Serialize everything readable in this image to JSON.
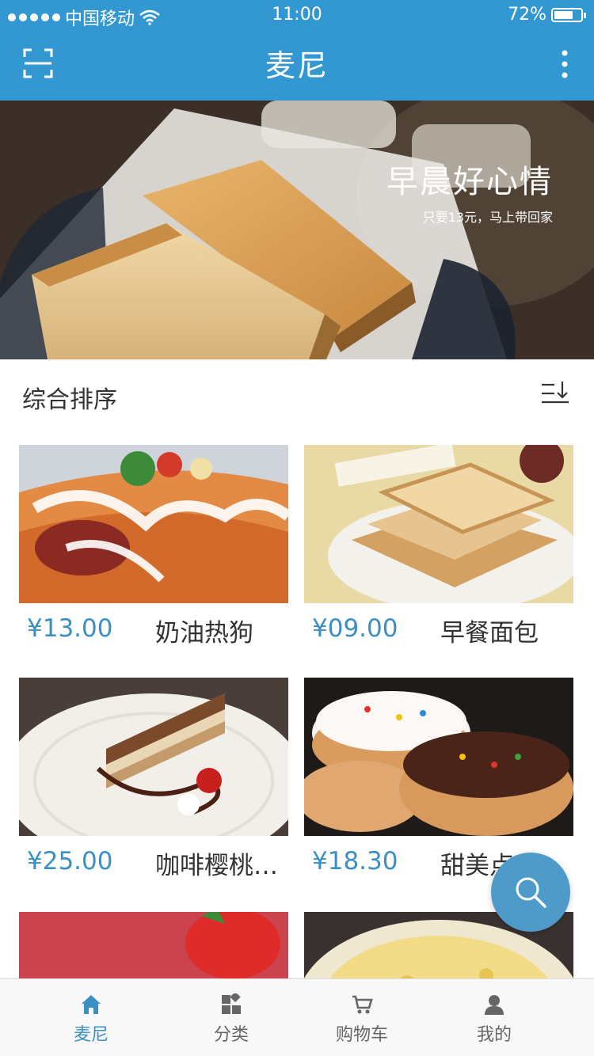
{
  "status_bar": {
    "carrier": "中国移动",
    "time": "11:00",
    "battery": "72%",
    "battery_level": 0.72,
    "wifi_icon": "wifi-icon"
  },
  "header": {
    "title": "麦尼",
    "left_icon": "scan-icon",
    "right_icon": "more-vertical-icon",
    "bg_color": "#3398d1"
  },
  "banner": {
    "title": "早晨好心情",
    "subtitle": "只要13元，马上带回家"
  },
  "sort": {
    "label": "综合排序",
    "icon": "sort-descending-icon"
  },
  "products": [
    {
      "price": "¥13.00",
      "name": "奶油热狗"
    },
    {
      "price": "¥09.00",
      "name": "早餐面包"
    },
    {
      "price": "¥25.00",
      "name": "咖啡樱桃蛋糕"
    },
    {
      "price": "¥18.30",
      "name": "甜美点心"
    },
    {
      "price": "",
      "name": ""
    },
    {
      "price": "",
      "name": ""
    }
  ],
  "fab": {
    "icon": "search-icon"
  },
  "tabs": [
    {
      "label": "麦尼",
      "icon": "home-icon",
      "active": true
    },
    {
      "label": "分类",
      "icon": "category-icon",
      "active": false
    },
    {
      "label": "购物车",
      "icon": "cart-icon",
      "active": false
    },
    {
      "label": "我的",
      "icon": "user-icon",
      "active": false
    }
  ],
  "colors": {
    "accent": "#3398d1",
    "price": "#3a8fc4",
    "fab": "#4e9bc9"
  }
}
